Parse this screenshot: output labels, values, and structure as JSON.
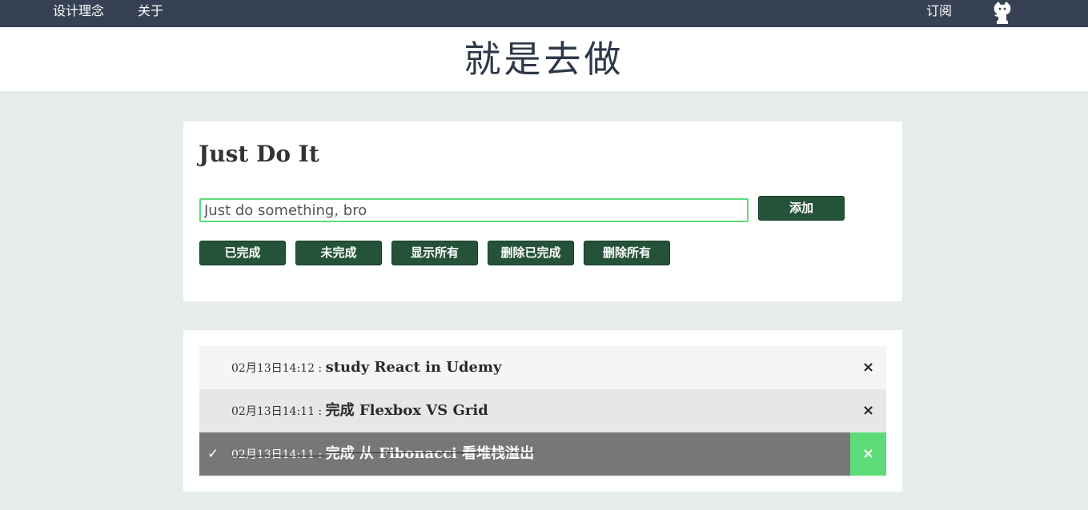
{
  "nav": {
    "left_links": [
      "设计理念",
      "关于"
    ],
    "right_link": "订阅",
    "github_icon": "github-octocat-icon"
  },
  "hero": {
    "title": "就是去做"
  },
  "app": {
    "title": "Just Do It",
    "input": {
      "value": "",
      "placeholder": "Just do something, bro"
    },
    "add_label": "添加",
    "filters": [
      "已完成",
      "未完成",
      "显示所有",
      "删除已完成",
      "删除所有"
    ]
  },
  "todos": [
    {
      "time": "02月13日14:12",
      "sep": " : ",
      "title": "study React in Udemy",
      "completed": false,
      "delete_icon": "×"
    },
    {
      "time": "02月13日14:11",
      "sep": " : ",
      "title": "完成 Flexbox VS Grid",
      "completed": false,
      "delete_icon": "×"
    },
    {
      "time": "02月13日14:11",
      "sep": " : ",
      "title": "完成 从 Fibonacci 看堆栈溢出",
      "completed": true,
      "check_icon": "✓",
      "delete_icon": "×"
    }
  ],
  "colors": {
    "nav_bg": "#364254",
    "page_bg": "#e6ebeb",
    "button_bg": "#25533a",
    "accent_green": "#5edb78",
    "completed_row_bg": "#777777"
  }
}
